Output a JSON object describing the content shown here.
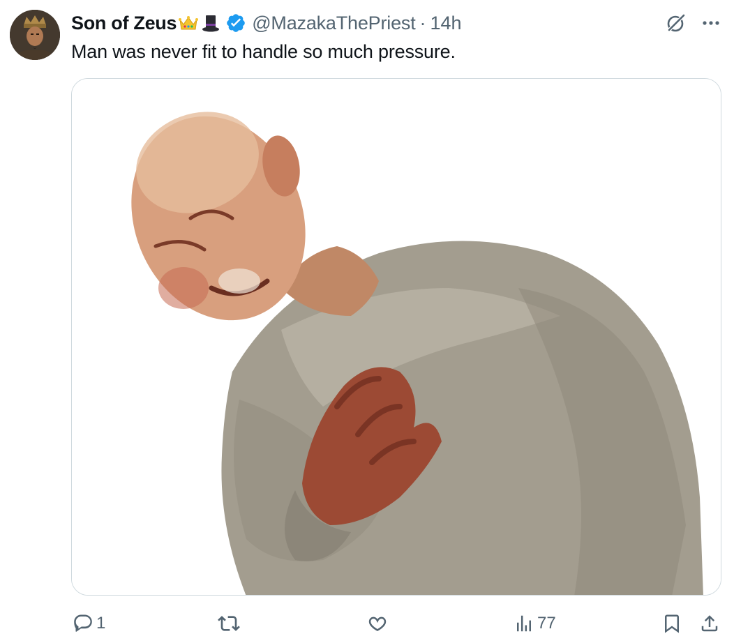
{
  "author": {
    "name": "Son of Zeus",
    "emoji_1": "crown-emoji",
    "emoji_2": "top-hat-emoji",
    "handle": "@MazakaThePriest",
    "separator": "·",
    "time": "14h",
    "verified_color": "#1d9bf0"
  },
  "tweet": {
    "text": "Man was never fit to handle so much pressure."
  },
  "actions": {
    "reply_count": "1",
    "retweet_count": "",
    "like_count": "",
    "views_count": "77"
  },
  "colors": {
    "text_primary": "#0f1419",
    "text_secondary": "#536471",
    "border": "#cfd9de",
    "accent": "#1d9bf0"
  }
}
